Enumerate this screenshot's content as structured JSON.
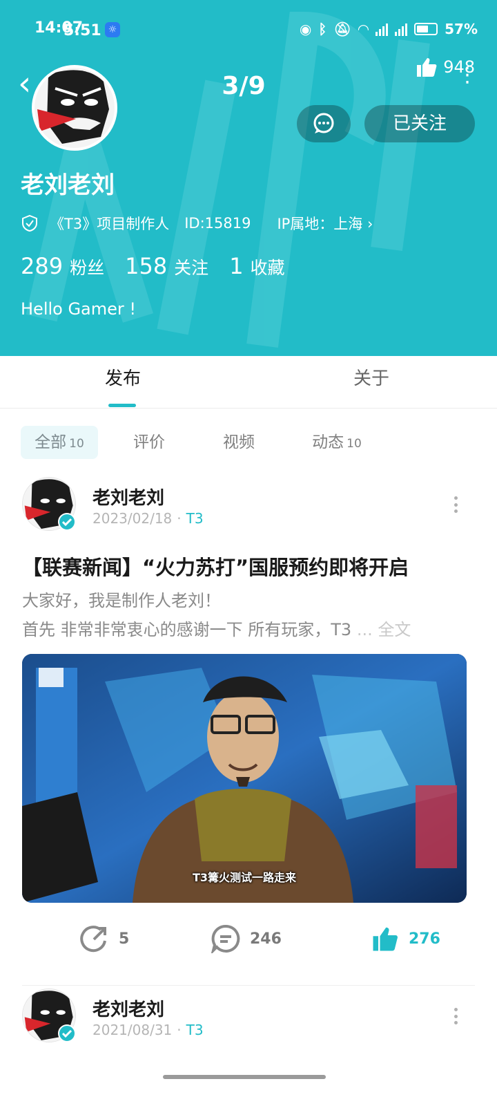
{
  "status_bar": {
    "time": "14:07",
    "time_overlay": "5:51",
    "battery": "57%"
  },
  "header": {
    "page_counter": "3/9",
    "like_count": "948",
    "follow_label": "已关注",
    "username": "老刘老刘",
    "role": "《T3》项目制作人",
    "user_id": "ID:15819",
    "ip_location": "IP属地：上海",
    "stats": {
      "fans_count": "289",
      "fans_label": "粉丝",
      "following_count": "158",
      "following_label": "关注",
      "favorites_count": "1",
      "favorites_label": "收藏"
    },
    "bio": "Hello Gamer !",
    "accent_color": "#22bcc8"
  },
  "tabs": [
    {
      "label": "发布",
      "active": true
    },
    {
      "label": "关于",
      "active": false
    }
  ],
  "filters": [
    {
      "label": "全部",
      "count": "10",
      "active": true
    },
    {
      "label": "评价",
      "count": ""
    },
    {
      "label": "视频",
      "count": ""
    },
    {
      "label": "动态",
      "count": "10"
    }
  ],
  "posts": [
    {
      "author": "老刘老刘",
      "date": "2023/02/18",
      "game": "T3",
      "title": "【联赛新闻】“火力苏打”国服预约即将开启",
      "excerpt_line1": "大家好，我是制作人老刘！",
      "excerpt_line2": "首先 非常非常衷心的感谢一下 所有玩家，T3",
      "excerpt_more": "... 全文",
      "video_caption": "T3篝火测试一路走来",
      "share_count": "5",
      "comment_count": "246",
      "like_count": "276"
    },
    {
      "author": "老刘老刘",
      "date": "2021/08/31",
      "game": "T3"
    }
  ]
}
